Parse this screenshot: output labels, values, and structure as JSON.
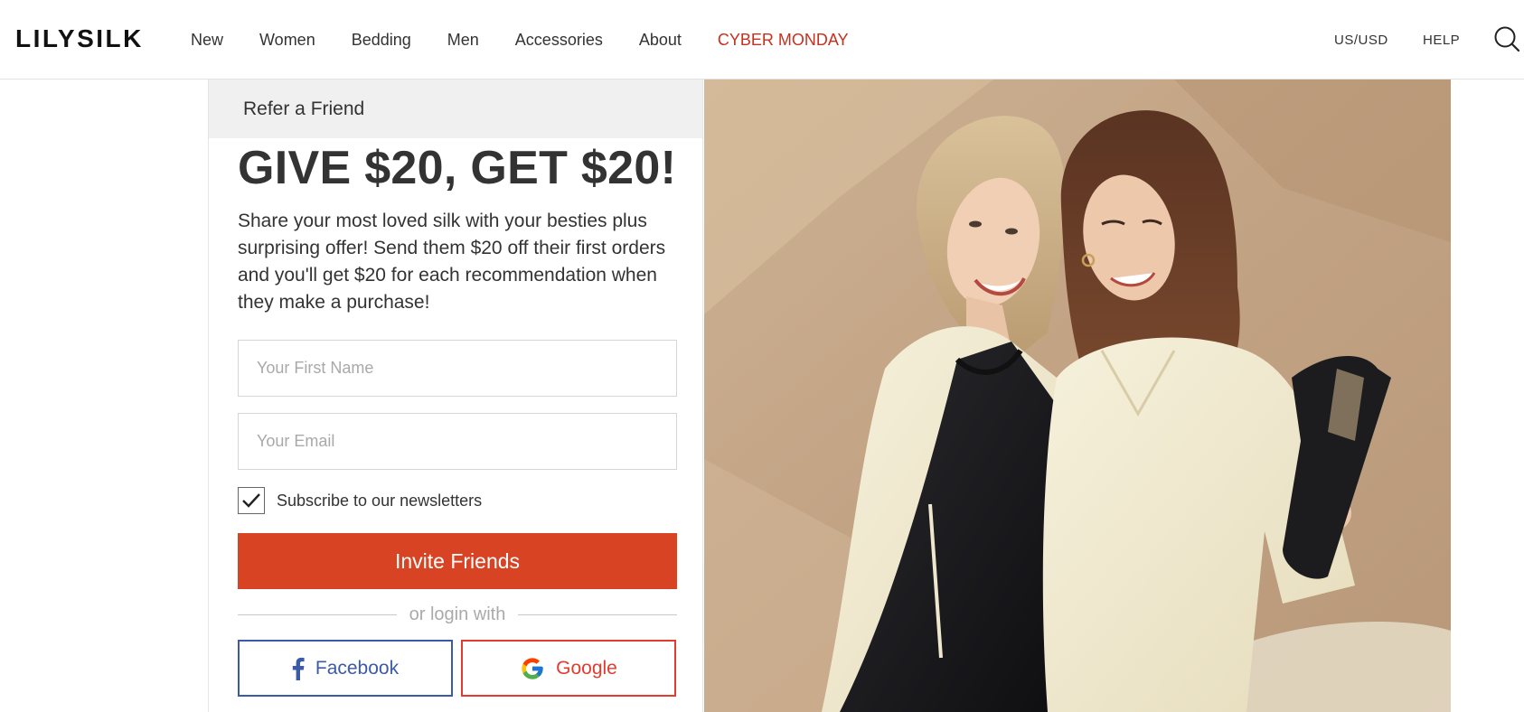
{
  "header": {
    "logo": "LILYSILK",
    "nav": [
      "New",
      "Women",
      "Bedding",
      "Men",
      "Accessories",
      "About",
      "CYBER MONDAY"
    ],
    "region": "US/USD",
    "help": "HELP",
    "search_icon": "search-icon"
  },
  "refer": {
    "tab_label": "Refer a Friend",
    "headline": "GIVE $20, GET $20!",
    "description": "Share your most loved silk with your besties plus surprising offer! Send them $20 off their first orders and you'll get $20 for each recommendation when they make a purchase!",
    "first_name_placeholder": "Your First Name",
    "email_placeholder": "Your Email",
    "subscribe_label": "Subscribe to our newsletters",
    "subscribe_checked": true,
    "invite_label": "Invite Friends",
    "divider_text": "or login with",
    "facebook_label": "Facebook",
    "google_label": "Google"
  },
  "colors": {
    "accent": "#d84323",
    "sale": "#c8301e",
    "facebook": "#3b5ba8",
    "google": "#e33b2e"
  }
}
